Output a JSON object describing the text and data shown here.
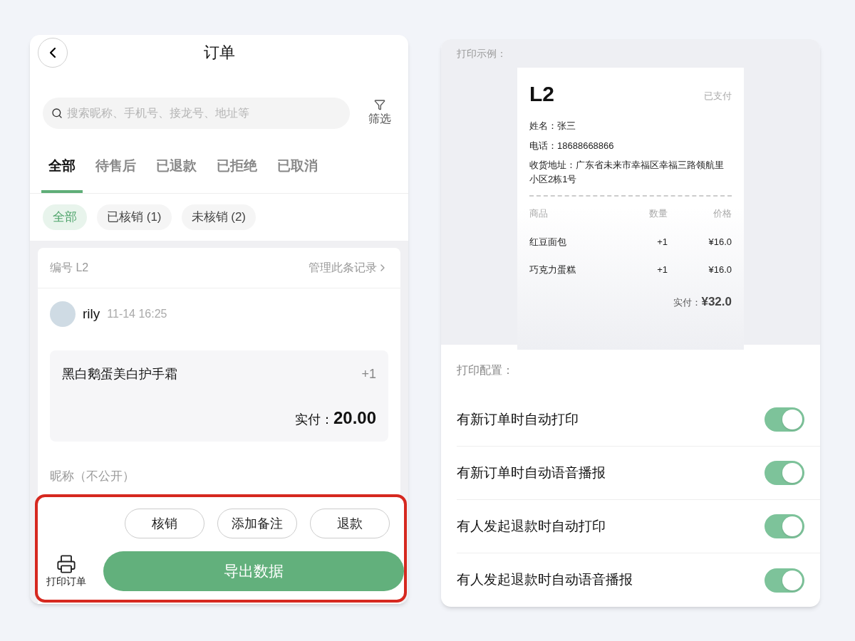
{
  "orders": {
    "title": "订单",
    "search": {
      "placeholder": "搜索昵称、手机号、接龙号、地址等"
    },
    "filter_label": "筛选",
    "tabs": [
      {
        "label": "全部",
        "selected": true
      },
      {
        "label": "待售后",
        "selected": false
      },
      {
        "label": "已退款",
        "selected": false
      },
      {
        "label": "已拒绝",
        "selected": false
      },
      {
        "label": "已取消",
        "selected": false
      }
    ],
    "chips": [
      {
        "label": "全部",
        "selected": true
      },
      {
        "label": "已核销 (1)",
        "selected": false
      },
      {
        "label": "未核销 (2)",
        "selected": false
      }
    ],
    "order": {
      "number": "编号 L2",
      "manage_link": "管理此条记录",
      "user": "rily",
      "time": "11-14 16:25",
      "product": "黑白鹅蛋美白护手霜",
      "quantity": "+1",
      "paid_label": "实付：",
      "paid_amount": "20.00",
      "nickname_label": "昵称（不公开）"
    },
    "actions": [
      "核销",
      "添加备注",
      "退款"
    ],
    "print_label": "打印订单",
    "export_button": "导出数据"
  },
  "print": {
    "sample_label": "打印示例：",
    "receipt": {
      "number": "L2",
      "status": "已支付",
      "name_line": "姓名：张三",
      "phone_line": "电话：18688668866",
      "address_line": "收货地址：广东省未来市幸福区幸福三路领航里小区2栋1号",
      "columns": [
        "商品",
        "数量",
        "价格"
      ],
      "items": [
        {
          "name": "红豆面包",
          "quantity": "+1",
          "price": "¥16.0"
        },
        {
          "name": "巧克力蛋糕",
          "quantity": "+1",
          "price": "¥16.0"
        }
      ],
      "paid_label": "实付：",
      "paid_amount": "¥32.0"
    },
    "config_label": "打印配置：",
    "settings": [
      {
        "label": "有新订单时自动打印",
        "on": true
      },
      {
        "label": "有新订单时自动语音播报",
        "on": true
      },
      {
        "label": "有人发起退款时自动打印",
        "on": true
      },
      {
        "label": "有人发起退款时自动语音播报",
        "on": true
      }
    ]
  }
}
